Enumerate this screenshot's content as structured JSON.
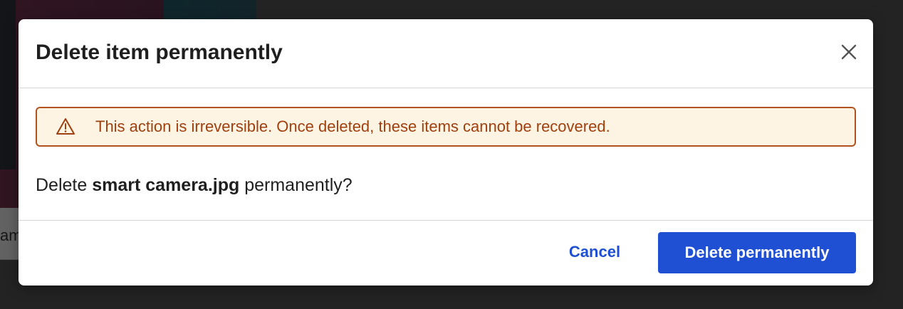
{
  "background": {
    "partial_text": "am"
  },
  "dialog": {
    "title": "Delete item permanently",
    "close_icon": "close-icon",
    "warning": {
      "icon": "warning-triangle-icon",
      "text": "This action is irreversible. Once deleted, these items cannot be recovered."
    },
    "question": {
      "prefix": "Delete ",
      "filename": "smart camera.jpg",
      "suffix": " permanently?"
    },
    "buttons": {
      "cancel": "Cancel",
      "delete": "Delete permanently"
    }
  },
  "colors": {
    "primary": "#1f4fd3",
    "warning_border": "#b2531f",
    "warning_background": "#fdf4e3",
    "warning_text": "#a0400f"
  }
}
